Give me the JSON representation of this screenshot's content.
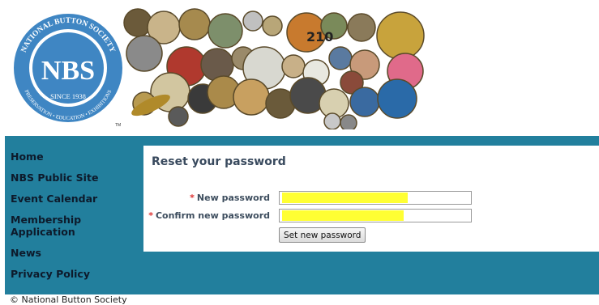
{
  "header": {
    "logo_text_top": "NATIONAL BUTTON SOCIETY",
    "logo_initials": "NBS",
    "logo_since": "SINCE 1938",
    "logo_text_bottom": "PRESERVATION • EDUCATION • EXHIBITIONS",
    "logo_tm": "TM",
    "collage_number": "210"
  },
  "sidebar": {
    "items": [
      {
        "label": "Home"
      },
      {
        "label": "NBS Public Site"
      },
      {
        "label": "Event Calendar"
      },
      {
        "label": "Membership Application"
      },
      {
        "label": "News"
      },
      {
        "label": "Privacy Policy"
      }
    ]
  },
  "form": {
    "title": "Reset your password",
    "required_marker": "*",
    "new_password_label": "New password",
    "confirm_password_label": "Confirm new password",
    "submit_label": "Set new password"
  },
  "footer": {
    "copyright": "© National Button Society"
  },
  "colors": {
    "teal": "#227f9d",
    "highlight": "#ffff33",
    "nav_text": "#0d1a2b"
  }
}
